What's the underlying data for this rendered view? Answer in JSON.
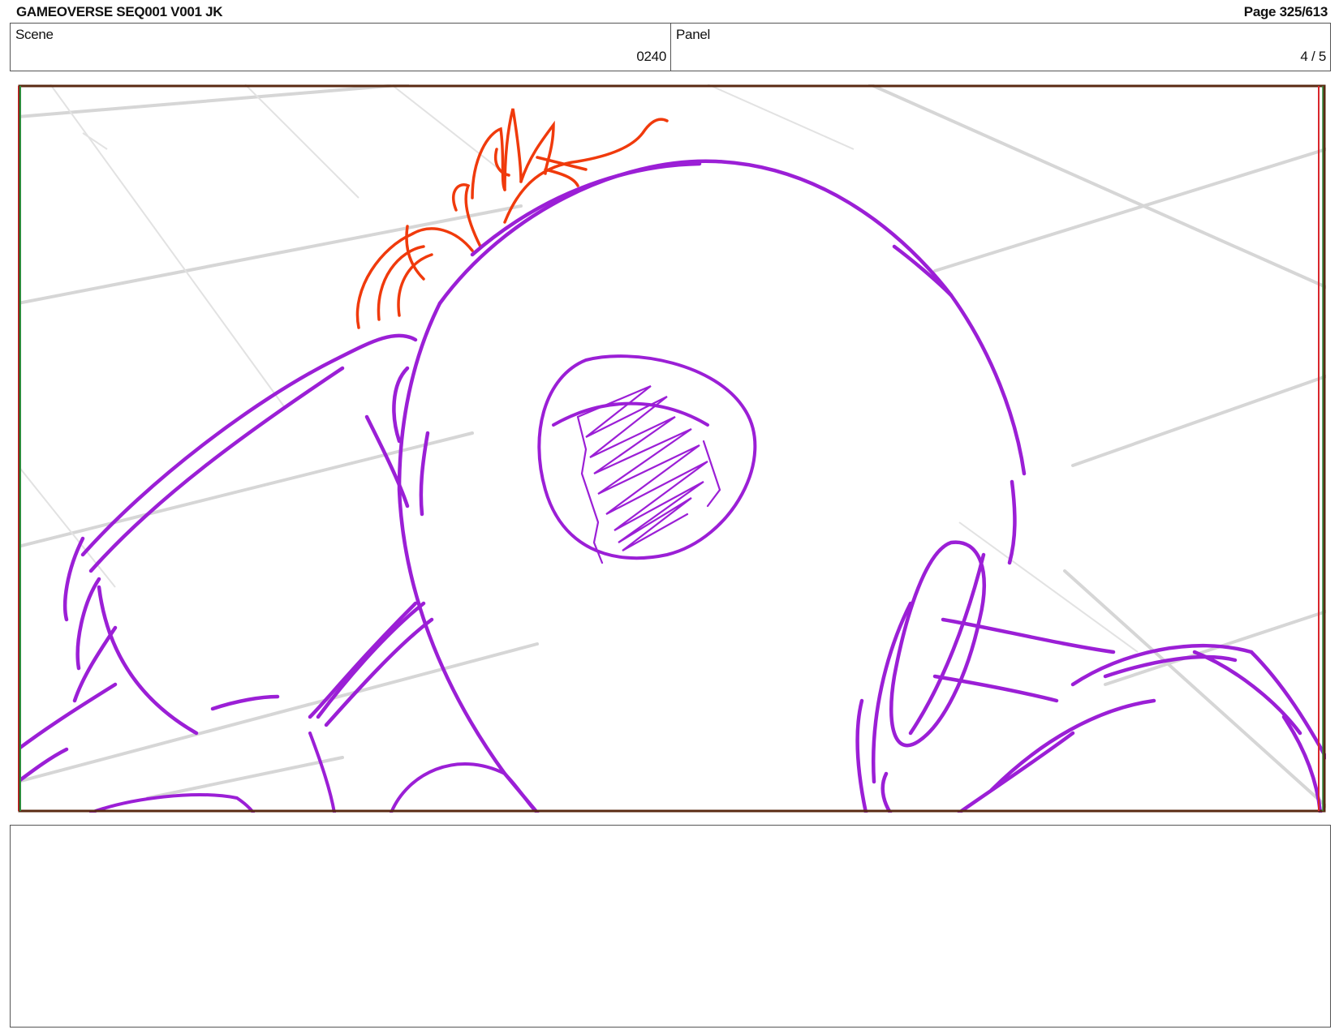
{
  "header": {
    "title": "GAMEOVERSE SEQ001 V001 JK",
    "page": "Page 325/613"
  },
  "info": {
    "scene_label": "Scene",
    "scene_value": "0240",
    "panel_label": "Panel",
    "panel_value": "4 / 5"
  },
  "colors": {
    "sketch_purple": "#9b1fd6",
    "sketch_orange": "#f03a0c",
    "frame_red": "#d9262c",
    "frame_green": "#2e8b3c",
    "frame_brown": "#5a2a12",
    "grid_gray": "#d4d4d4"
  },
  "notes": {
    "text": ""
  }
}
